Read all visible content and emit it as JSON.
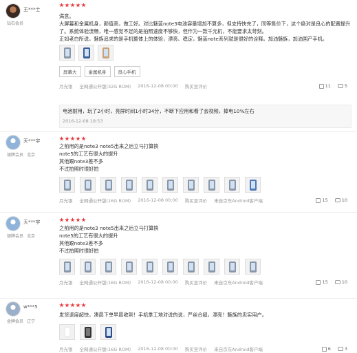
{
  "reviews": [
    {
      "user": "王***士",
      "level": "钻石会员",
      "location": "",
      "rating": 5,
      "text": [
        "满意。",
        "大屏幕和金属机身，颜值高，做工好。对比魅蓝note3电池容量增加不算多，但支持快充了，同等售价下，这个绝对是良心的配置提升了。系统体验流畅，唯一感觉不足的是拍照速度不够快，但作为一款千元机，不能要求太苛刻。",
        "正如老白所说，魅族追求的是手机整体上的体验，漂亮、稳定，魅蓝note系列就是很好的诠释。加油魅族，加油国产手机。"
      ],
      "tags": [
        "屏幕大",
        "金属机身",
        "良心手机"
      ],
      "meta": [
        "月光银",
        "全网通公开版(32G ROM)",
        "2016-12-08 00:00",
        "购买至评价"
      ],
      "likes": "11",
      "comments": "5",
      "followup": {
        "text": "电池耐用，玩了2小时，亮屏时间1小时34分，不断下应用和看了会视频，掉电10%左右",
        "date": "2016-12-08 18:53"
      }
    },
    {
      "user": "天***宇",
      "level": "银牌会员",
      "location": "北京",
      "rating": 5,
      "text": [
        "之前用的是note3 note5出来之后立马打算换",
        "note5的工艺有很大的提升",
        "其他跟note3差不多",
        "不过拍照时很好拍"
      ],
      "meta": [
        "月光银",
        "全网通公开版(16G ROM)",
        "2016-12-08 00:00",
        "购买至评价",
        "来自京东Android客户端"
      ],
      "likes": "15",
      "comments": "10"
    },
    {
      "user": "天***宇",
      "level": "银牌会员",
      "location": "北京",
      "rating": 5,
      "text": [
        "之前用的是note3 note5出来之后立马打算换",
        "note5的工艺有很大的提升",
        "其他跟note3差不多",
        "不过拍照时很好拍"
      ],
      "meta": [
        "月光银",
        "全网通公开版(16G ROM)",
        "2016-12-08 00:00",
        "购买至评价",
        "来自京东Android客户端"
      ],
      "likes": "15",
      "comments": "10"
    },
    {
      "user": "w***5",
      "level": "金牌会员",
      "location": "辽宁",
      "rating": 5,
      "text": [
        "发货速度超快，凑晨下单早晨收到！手机拿工地对说的说，严丝合缝，漂亮！魅族的忠实用户。"
      ],
      "meta": [
        "月光银",
        "全网通公开版(16G ROM)",
        "2016-12-08 00:00",
        "购买至评价",
        "来自京东Android客户端"
      ],
      "likes": "6",
      "comments": "3"
    }
  ]
}
